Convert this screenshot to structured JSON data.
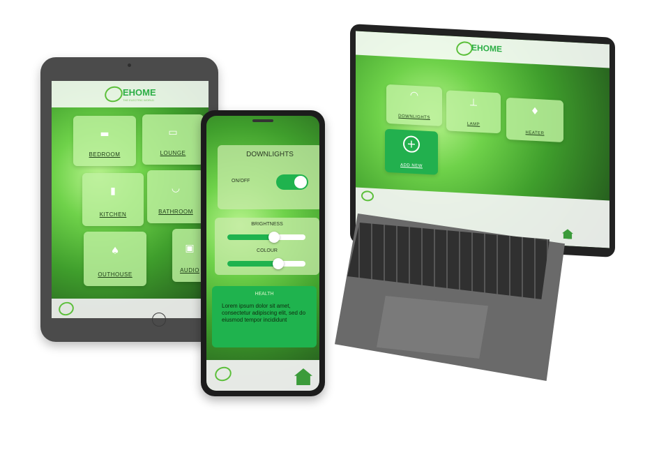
{
  "brand": {
    "name": "EHOME",
    "tagline": "THE ELECTRIC WORLD"
  },
  "tablet": {
    "rooms": [
      {
        "label": "BEDROOM",
        "icon": "bed-icon"
      },
      {
        "label": "LOUNGE",
        "icon": "sofa-icon"
      },
      {
        "label": "KITCHEN",
        "icon": "fridge-icon"
      },
      {
        "label": "BATHROOM",
        "icon": "bathtub-icon"
      },
      {
        "label": "OUTHOUSE",
        "icon": "tree-icon"
      },
      {
        "label": "AUDIO",
        "icon": "speaker-icon"
      }
    ]
  },
  "phone": {
    "title": "DOWNLIGHTS",
    "toggle_label": "ON/OFF",
    "toggle_on": true,
    "brightness_label": "BRIGHTNESS",
    "brightness_value": 0.6,
    "colour_label": "COLOUR",
    "colour_value": 0.65,
    "health_title": "HEALTH",
    "health_text": "Lorem ipsum dolor sit amet, consectetur adipiscing elit, sed do eiusmod tempor incididunt"
  },
  "laptop": {
    "devices": [
      {
        "label": "DOWNLIGHTS",
        "icon": "downlight-icon"
      },
      {
        "label": "LAMP",
        "icon": "lamp-icon"
      },
      {
        "label": "HEATER",
        "icon": "flame-icon"
      }
    ],
    "add_label": "ADD NEW"
  },
  "colors": {
    "accent": "#1fb34e",
    "tile": "#c4f0a8",
    "home": "#3b9b3a"
  }
}
